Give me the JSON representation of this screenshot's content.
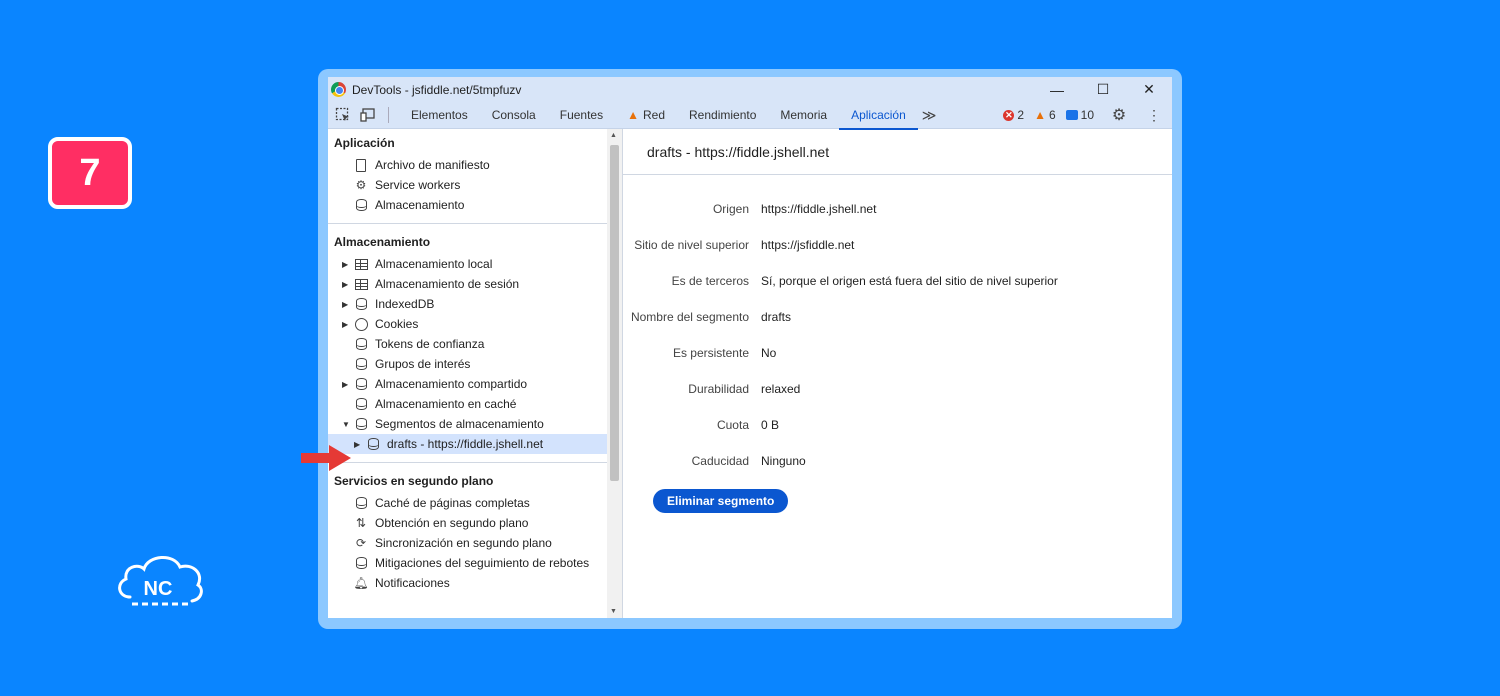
{
  "step": {
    "number": "7"
  },
  "brand": {
    "logo_text": "NC"
  },
  "window": {
    "title": "DevTools - jsfiddle.net/5tmpfuzv",
    "controls": {
      "minimize": "—",
      "maximize": "☐",
      "close": "✕"
    }
  },
  "tabs": [
    {
      "label": "Elementos"
    },
    {
      "label": "Consola"
    },
    {
      "label": "Fuentes"
    },
    {
      "label": "Red",
      "icon": "warning-icon"
    },
    {
      "label": "Rendimiento"
    },
    {
      "label": "Memoria"
    },
    {
      "label": "Aplicación",
      "active": true
    }
  ],
  "status": {
    "errors": "2",
    "warnings": "6",
    "messages": "10"
  },
  "sidebar": {
    "sections": [
      {
        "title": "Aplicación",
        "items": [
          {
            "label": "Archivo de manifiesto",
            "icon": "document-icon"
          },
          {
            "label": "Service workers",
            "icon": "gears-icon"
          },
          {
            "label": "Almacenamiento",
            "icon": "database-icon"
          }
        ]
      },
      {
        "title": "Almacenamiento",
        "items": [
          {
            "label": "Almacenamiento local",
            "icon": "table-icon",
            "expandable": true
          },
          {
            "label": "Almacenamiento de sesión",
            "icon": "table-icon",
            "expandable": true
          },
          {
            "label": "IndexedDB",
            "icon": "database-icon",
            "expandable": true
          },
          {
            "label": "Cookies",
            "icon": "cookie-icon",
            "expandable": true
          },
          {
            "label": "Tokens de confianza",
            "icon": "database-icon"
          },
          {
            "label": "Grupos de interés",
            "icon": "database-icon"
          },
          {
            "label": "Almacenamiento compartido",
            "icon": "database-icon",
            "expandable": true
          },
          {
            "label": "Almacenamiento en caché",
            "icon": "database-icon"
          },
          {
            "label": "Segmentos de almacenamiento",
            "icon": "database-icon",
            "expanded": true
          },
          {
            "label": "drafts - https://fiddle.jshell.net",
            "icon": "database-icon",
            "expandable": true,
            "child": true,
            "selected": true
          }
        ]
      },
      {
        "title": "Servicios en segundo plano",
        "items": [
          {
            "label": "Caché de páginas completas",
            "icon": "database-icon"
          },
          {
            "label": "Obtención en segundo plano",
            "icon": "updown-arrows-icon"
          },
          {
            "label": "Sincronización en segundo plano",
            "icon": "sync-icon"
          },
          {
            "label": "Mitigaciones del seguimiento de rebotes",
            "icon": "database-icon"
          },
          {
            "label": "Notificaciones",
            "icon": "bell-icon"
          }
        ]
      }
    ]
  },
  "details": {
    "title": "drafts - https://fiddle.jshell.net",
    "rows": [
      {
        "key": "Origen",
        "value": "https://fiddle.jshell.net"
      },
      {
        "key": "Sitio de nivel superior",
        "value": "https://jsfiddle.net"
      },
      {
        "key": "Es de terceros",
        "value": "Sí, porque el origen está fuera del sitio de nivel superior"
      },
      {
        "key": "Nombre del segmento",
        "value": "drafts"
      },
      {
        "key": "Es persistente",
        "value": "No"
      },
      {
        "key": "Durabilidad",
        "value": "relaxed"
      },
      {
        "key": "Cuota",
        "value": "0 B"
      },
      {
        "key": "Caducidad",
        "value": "Ninguno"
      }
    ],
    "delete_label": "Eliminar segmento"
  },
  "colors": {
    "background": "#0a85ff",
    "badge": "#ff2e63",
    "accent": "#0b57d0",
    "pointer_arrow": "#e53935"
  }
}
